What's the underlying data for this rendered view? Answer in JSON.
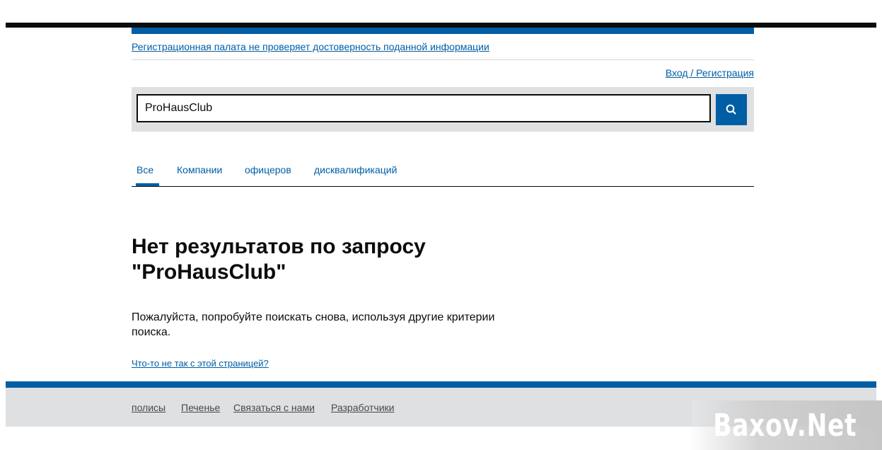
{
  "header": {
    "notice": "Регистрационная палата не проверяет достоверность поданной информации",
    "login_link": "Вход / Регистрация"
  },
  "search": {
    "value": "ProHausClub",
    "button_icon": "search-icon"
  },
  "tabs": [
    {
      "label": "Все",
      "active": true
    },
    {
      "label": "Компании",
      "active": false
    },
    {
      "label": "офицеров",
      "active": false
    },
    {
      "label": "дисквалификаций",
      "active": false
    }
  ],
  "main": {
    "heading": "Нет результатов по запросу \"ProHausClub\"",
    "message": "Пожалуйста, попробуйте поискать снова, используя другие критерии поиска.",
    "feedback_link": "Что-то не так с этой страницей?"
  },
  "footer": {
    "links": [
      "полисы",
      "Печенье",
      "Связаться с нами",
      "Разработчики"
    ]
  },
  "watermark": {
    "text": "Baxov.Net"
  },
  "colors": {
    "accent": "#005ea5",
    "panel": "#dee0e2",
    "text": "#0b0c0c"
  }
}
